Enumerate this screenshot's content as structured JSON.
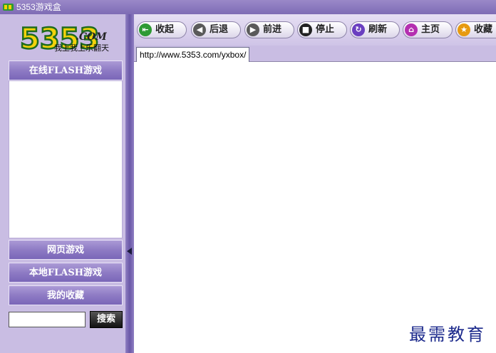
{
  "window": {
    "title": "5353游戏盒"
  },
  "logo": {
    "brand": "5353",
    "brand_suffix": ".COM",
    "slogan": "我上我上乐翻天"
  },
  "sidebar": {
    "panel_title": "在线FLASH游戏",
    "buttons": [
      "网页游戏",
      "本地FLASH游戏",
      "我的收藏"
    ],
    "search": {
      "value": "",
      "button_label": "搜索"
    }
  },
  "toolbar": {
    "buttons": [
      {
        "label": "收起",
        "icon": "collapse-icon",
        "color": "#2e9a34"
      },
      {
        "label": "后退",
        "icon": "back-arrow-icon",
        "color": "#5a5a5a"
      },
      {
        "label": "前进",
        "icon": "forward-arrow-icon",
        "color": "#5a5a5a"
      },
      {
        "label": "停止",
        "icon": "stop-icon",
        "color": "#222222"
      },
      {
        "label": "刷新",
        "icon": "refresh-icon",
        "color": "#6a3fc0"
      },
      {
        "label": "主页",
        "icon": "home-icon",
        "color": "#b42fb0"
      },
      {
        "label": "收藏",
        "icon": "star-icon",
        "color": "#e79a10"
      }
    ]
  },
  "browser": {
    "tab_url": "http://www.5353.com/yxbox/"
  },
  "watermark": "最需教育",
  "colors": {
    "accent": "#8e7bc4",
    "background": "#c9bde3"
  }
}
